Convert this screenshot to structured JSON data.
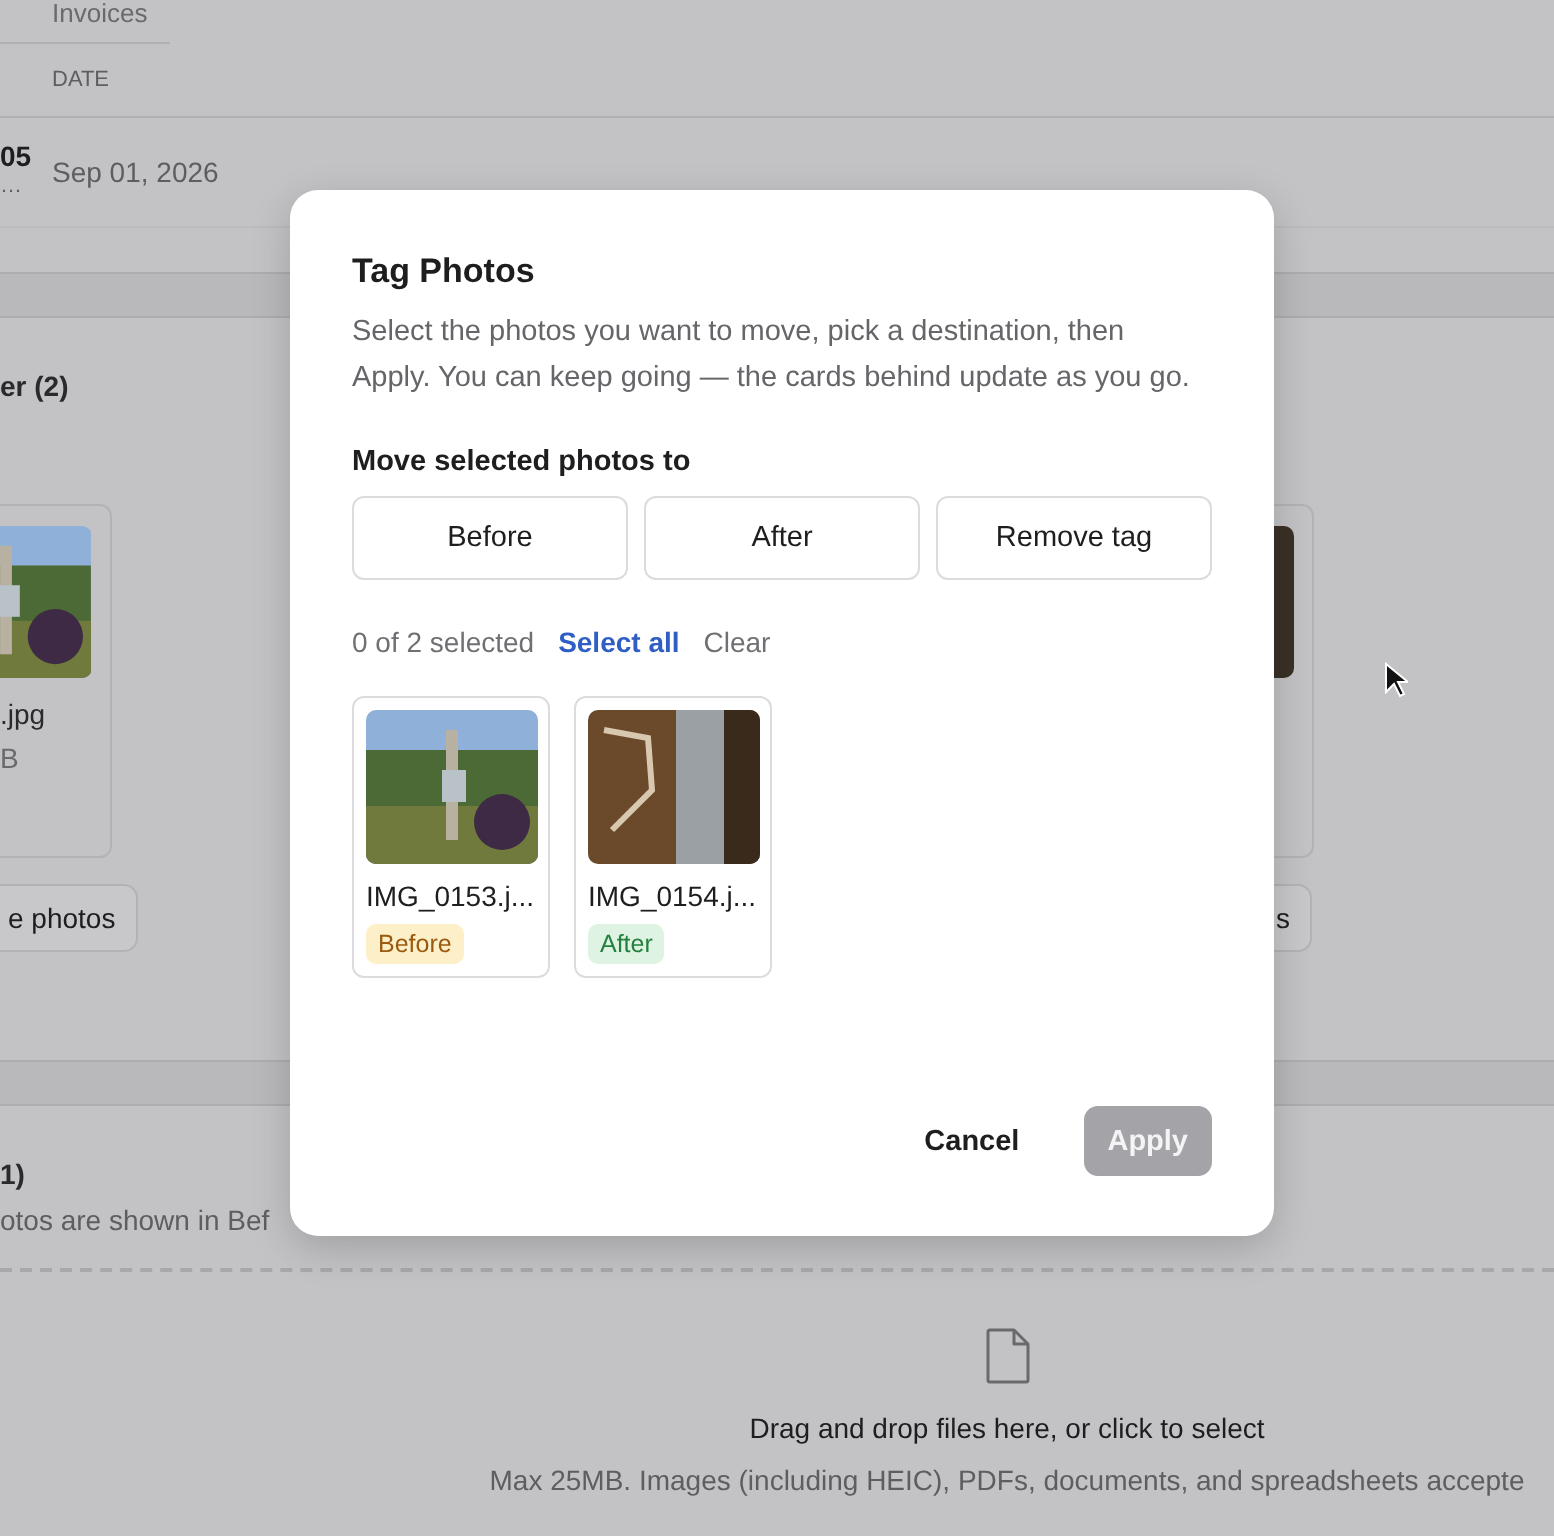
{
  "background": {
    "tab": "Invoices",
    "table": {
      "columns": [
        "DATE"
      ],
      "rows": [
        {
          "column_1": "05",
          "column_1_sub": "…",
          "date": "Sep 01, 2026"
        }
      ]
    },
    "photo_section": {
      "heading": "er (2)",
      "left_card": {
        "filename": ".jpg",
        "size": "B"
      },
      "left_button": "e photos",
      "right_button": "s"
    },
    "note_section": {
      "heading": "1)",
      "text": "otos are shown in Bef"
    },
    "dropzone": {
      "title": "Drag and drop files here, or click to select",
      "hint": "Max 25MB. Images (including HEIC), PDFs, documents, and spreadsheets accepte"
    }
  },
  "dialog": {
    "title": "Tag Photos",
    "description": "Select the photos you want to move, pick a destination, then Apply. You can keep going — the cards behind update as you go.",
    "move_label": "Move selected photos to",
    "destinations": [
      "Before",
      "After",
      "Remove tag"
    ],
    "selection_count": "0 of 2 selected",
    "select_all": "Select all",
    "clear": "Clear",
    "photos": [
      {
        "filename": "IMG_0153.j...",
        "tag": "Before",
        "kind": "before",
        "selected": false
      },
      {
        "filename": "IMG_0154.j...",
        "tag": "After",
        "kind": "after",
        "selected": false
      }
    ],
    "buttons": [
      {
        "label": "Cancel",
        "kind": "text",
        "disabled": false
      },
      {
        "label": "Apply",
        "kind": "primary",
        "disabled": true
      }
    ]
  }
}
